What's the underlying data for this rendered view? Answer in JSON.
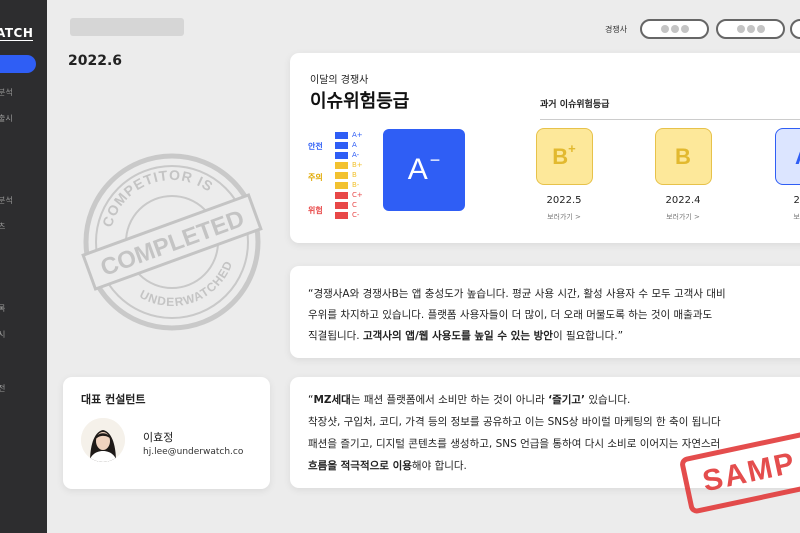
{
  "sidebar": {
    "brand": "ATCH",
    "items": [
      "분석",
      "출시",
      "분석",
      "츠",
      "록",
      "시",
      "전"
    ]
  },
  "header": {
    "date": "2022.6",
    "competitor_label": "경쟁사"
  },
  "issue": {
    "subtitle": "이달의 경쟁사",
    "title": "이슈위험등급",
    "levels": [
      {
        "label": "안전",
        "color": "#2f5ef5"
      },
      {
        "label": "주의",
        "color": "#f2c230"
      },
      {
        "label": "위험",
        "color": "#e84848"
      }
    ],
    "scale": [
      {
        "grade": "A+",
        "color": "#2f5ef5"
      },
      {
        "grade": "A",
        "color": "#2f5ef5"
      },
      {
        "grade": "A-",
        "color": "#2f5ef5"
      },
      {
        "grade": "B+",
        "color": "#f2c230"
      },
      {
        "grade": "B",
        "color": "#f2c230"
      },
      {
        "grade": "B-",
        "color": "#f2c230"
      },
      {
        "grade": "C+",
        "color": "#e84848"
      },
      {
        "grade": "C",
        "color": "#e84848"
      },
      {
        "grade": "C-",
        "color": "#e84848"
      }
    ],
    "current_grade": {
      "letter": "A",
      "modifier": "−"
    },
    "past_title": "과거 이슈위험등급",
    "past": [
      {
        "letter": "B",
        "modifier": "+",
        "date": "2022.5",
        "link": "보러가기 >",
        "bg": "#fde89a",
        "border": "#e7c24a",
        "fg": "#e2b92f"
      },
      {
        "letter": "B",
        "modifier": "",
        "date": "2022.4",
        "link": "보러가기 >",
        "bg": "#fde89a",
        "border": "#e7c24a",
        "fg": "#e2b92f"
      },
      {
        "letter": "A",
        "modifier": "",
        "date": "202",
        "link": "보러가",
        "bg": "#dce5ff",
        "border": "#2f5ef5",
        "fg": "#2f5ef5"
      }
    ]
  },
  "quote1": {
    "line1": "“경쟁사A와 경쟁사B는 앱 충성도가 높습니다. 평균 사용 시간, 활성 사용자 수 모두 고객사 대비",
    "line2": "우위를 차지하고 있습니다. 플랫폼 사용자들이 더 많이, 더 오래 머물도록 하는 것이 매출과도",
    "line3_pre": "직결됩니다. ",
    "line3_bold": "고객사의 앱/웹 사용도를 높일 수 있는 방안",
    "line3_post": "이 필요합니다.”"
  },
  "quote2": {
    "line1_pre": "“",
    "line1_b1": "MZ세대",
    "line1_mid": "는 패션 플랫폼에서 소비만 하는 것이 아니라 ",
    "line1_b2": "‘즐기고’",
    "line1_post": " 있습니다.",
    "line2": "착장샷, 구입처, 코디, 가격 등의 정보를 공유하고 이는 SNS상 바이럴 마케팅의 한 축이 됩니다",
    "line3": "패션을 즐기고, 디지털 콘텐츠를 생성하고, SNS 언급을 통하여 다시 소비로 이어지는 자연스러",
    "line4_bold": "흐름을 적극적으로 이용",
    "line4_post": "해야 합니다."
  },
  "consultant": {
    "title": "대표 컨설턴트",
    "name": "이효정",
    "email": "hj.lee@underwatch.co"
  },
  "stamp": {
    "top_text": "COMPETITOR IS",
    "main_text": "COMPLETED",
    "bottom_text": "UNDERWATCHED"
  },
  "sample_stamp": "SAMP"
}
